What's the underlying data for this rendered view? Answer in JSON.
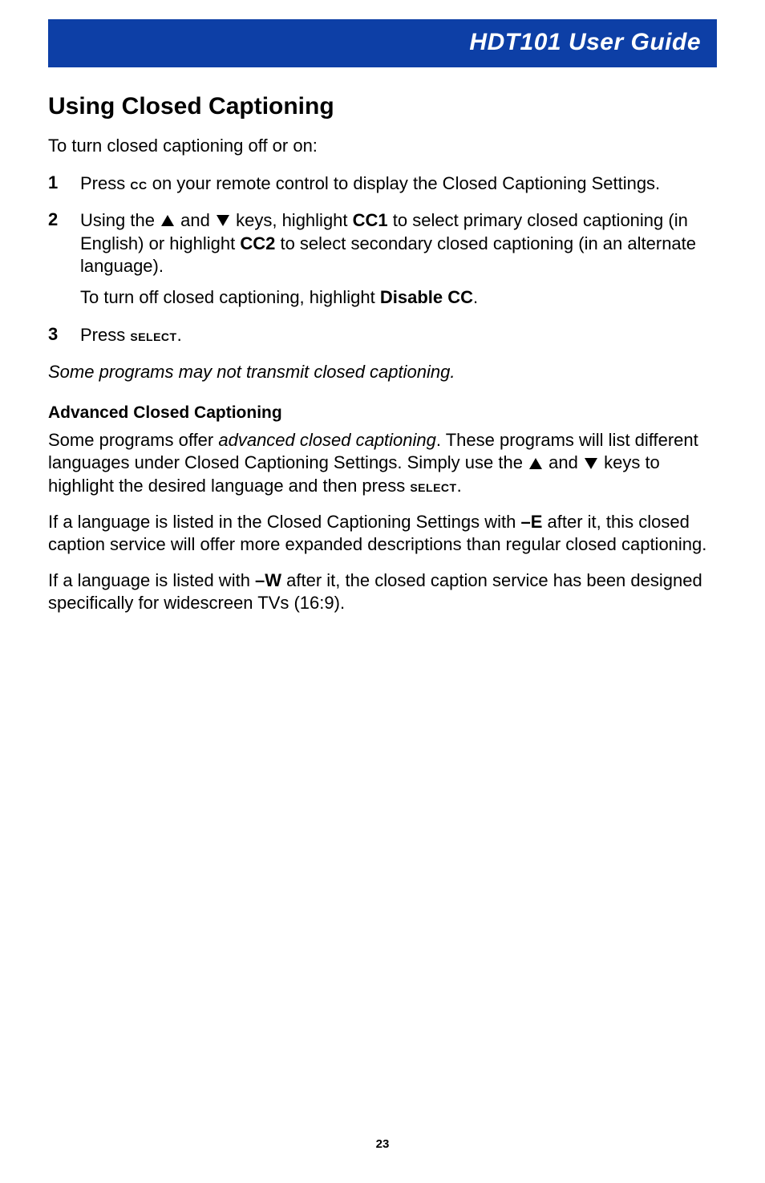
{
  "banner": {
    "title": "HDT101 User Guide"
  },
  "section": {
    "heading": "Using Closed Captioning",
    "lead": "To turn closed captioning off or on:"
  },
  "steps": {
    "s1": {
      "num": "1",
      "t1": "Press ",
      "cc": "cc",
      "t2": " on your remote control to display the Closed Captioning Settings."
    },
    "s2": {
      "num": "2",
      "t1": "Using the ",
      "and": " and ",
      "t2": " keys, highlight ",
      "cc1": "CC1",
      "t3": " to select primary closed captioning (in English) or highlight ",
      "cc2": "CC2",
      "t4": " to select secondary closed captioning (in an alternate language).",
      "sub1": "To turn off closed captioning, highlight ",
      "disable": "Disable CC",
      "sub2": "."
    },
    "s3": {
      "num": "3",
      "t1": "Press ",
      "select": "select",
      "t2": "."
    }
  },
  "note": "Some programs may not transmit closed captioning.",
  "advanced": {
    "heading": "Advanced Closed Captioning",
    "p1a": "Some programs offer ",
    "p1b": "advanced closed captioning",
    "p1c": ". These programs will list different languages under Closed Captioning Settings. Simply use the ",
    "p1and": " and ",
    "p1d": " keys to highlight the desired language and then press ",
    "p1select": "select",
    "p1e": ".",
    "p2a": "If a language is listed in the Closed Captioning Settings with ",
    "p2e": "–E",
    "p2b": " after it, this closed caption service will offer more expanded descriptions than regular closed captioning.",
    "p3a": "If a language is listed with ",
    "p3w": "–W",
    "p3b": " after it, the closed caption service has been designed specifically for widescreen TVs (16:9)."
  },
  "page": "23"
}
